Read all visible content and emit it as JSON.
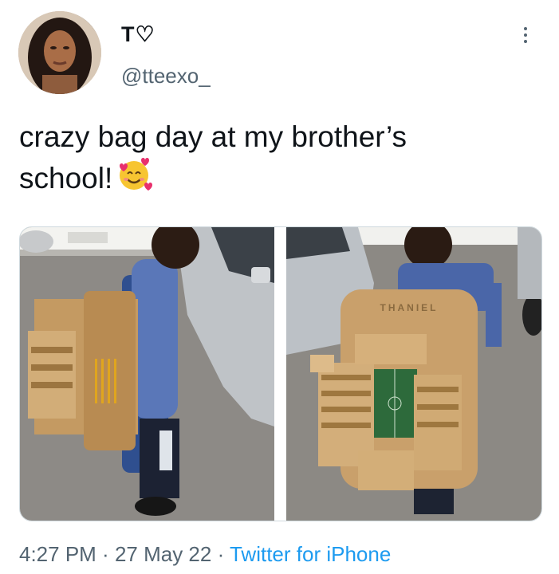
{
  "user": {
    "display_name": "T♡",
    "handle": "@tteexo_"
  },
  "tweet": {
    "text_line1": "crazy bag day at my brother’s",
    "text_line2": "school!",
    "emoji_icon": "smiling-face-with-hearts-icon"
  },
  "media": {
    "count": 2,
    "bag_lettering": "THANIEL"
  },
  "meta": {
    "time": "4:27 PM",
    "separator1": " · ",
    "date": "27 May 22",
    "separator2": " · ",
    "source": "Twitter for iPhone"
  },
  "colors": {
    "text": "#0f1419",
    "secondary": "#536471",
    "link": "#1d9bf0",
    "cardboard": "#c9a06b"
  }
}
